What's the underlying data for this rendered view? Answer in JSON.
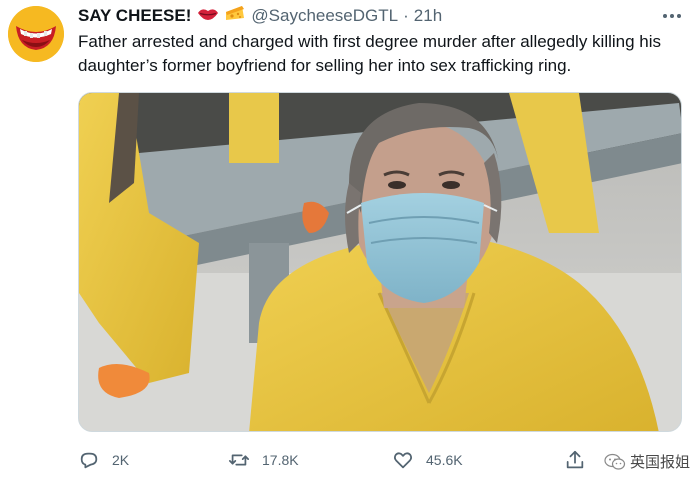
{
  "account": {
    "display_name": "SAY CHEESE!",
    "handle": "@SaycheeseDGTL",
    "separator": "·",
    "time": "21h",
    "emojis": [
      "lips-icon",
      "cheese-icon"
    ],
    "avatar": "say-cheese-logo"
  },
  "tweet": {
    "text": "Father arrested and charged with first degree murder after allegedly killing his daughter’s former boyfriend for selling her into sex trafficking ring."
  },
  "media": {
    "type": "photo",
    "colors": {
      "jumpsuit": "#ecc945",
      "mask": "#8fc3d6",
      "background": "#c8c8c4"
    }
  },
  "actions": {
    "reply": {
      "icon": "reply-icon",
      "count": "2K"
    },
    "retweet": {
      "icon": "retweet-icon",
      "count": "17.8K"
    },
    "like": {
      "icon": "heart-icon",
      "count": "45.6K"
    },
    "share": {
      "icon": "share-icon"
    }
  },
  "watermark": {
    "text": "英国报姐",
    "icon": "wechat-icon"
  },
  "colors": {
    "text_primary": "#0f1419",
    "text_secondary": "#536471",
    "border": "#cfd9de",
    "avatar_bg": "#f6b921"
  }
}
